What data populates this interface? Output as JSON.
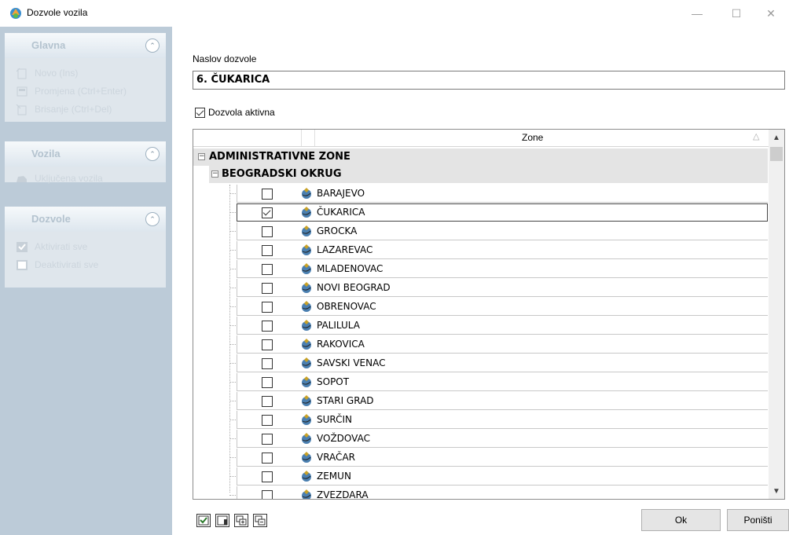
{
  "window": {
    "title": "Dozvole vozila"
  },
  "sidebar": {
    "groups": [
      {
        "title": "Glavna",
        "items": [
          {
            "label": "Novo (Ins)",
            "icon": "new-icon"
          },
          {
            "label": "Promjena (Ctrl+Enter)",
            "icon": "edit-icon"
          },
          {
            "label": "Brisanje (Ctrl+Del)",
            "icon": "delete-icon"
          }
        ]
      },
      {
        "title": "Vozila",
        "items": [
          {
            "label": "Uključena vozila",
            "icon": "vehicle-icon"
          }
        ]
      },
      {
        "title": "Dozvole",
        "items": [
          {
            "label": "Aktivirati sve",
            "icon": "check-all-icon"
          },
          {
            "label": "Deaktivirati sve",
            "icon": "uncheck-all-icon"
          }
        ]
      }
    ]
  },
  "form": {
    "naslov_label": "Naslov dozvole",
    "naslov_value": "6. ČUKARICA",
    "aktivna_label": "Dozvola aktivna",
    "aktivna_checked": true
  },
  "grid": {
    "column_header": "Zone",
    "group1": "ADMINISTRATIVNE ZONE",
    "group2": "BEOGRADSKI OKRUG",
    "rows": [
      {
        "name": "BARAJEVO",
        "checked": false
      },
      {
        "name": "ČUKARICA",
        "checked": true
      },
      {
        "name": "GROCKA",
        "checked": false
      },
      {
        "name": "LAZAREVAC",
        "checked": false
      },
      {
        "name": "MLADENOVAC",
        "checked": false
      },
      {
        "name": "NOVI BEOGRAD",
        "checked": false
      },
      {
        "name": "OBRENOVAC",
        "checked": false
      },
      {
        "name": "PALILULA",
        "checked": false
      },
      {
        "name": "RAKOVICA",
        "checked": false
      },
      {
        "name": "SAVSKI VENAC",
        "checked": false
      },
      {
        "name": "SOPOT",
        "checked": false
      },
      {
        "name": "STARI GRAD",
        "checked": false
      },
      {
        "name": "SURČIN",
        "checked": false
      },
      {
        "name": "VOŽDOVAC",
        "checked": false
      },
      {
        "name": "VRAČAR",
        "checked": false
      },
      {
        "name": "ZEMUN",
        "checked": false
      },
      {
        "name": "ZVEZDARA",
        "checked": false
      }
    ]
  },
  "buttons": {
    "ok": "Ok",
    "cancel": "Poništi"
  },
  "colors": {
    "sidebar_bg": "#bccbd8",
    "group_row_bg": "#e4e4e4",
    "button_bg": "#e5e5e5"
  }
}
